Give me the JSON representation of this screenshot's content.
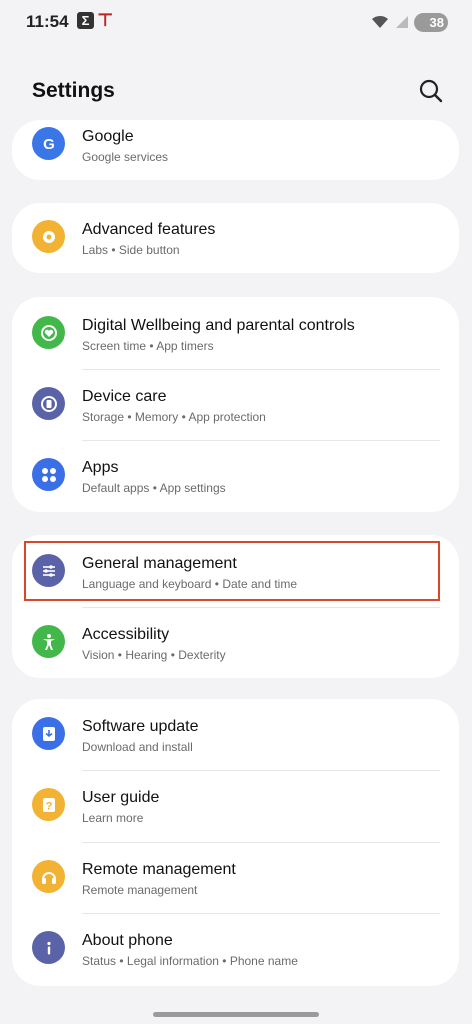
{
  "status": {
    "time": "11:54",
    "battery": "38"
  },
  "header": {
    "title": "Settings"
  },
  "colors": {
    "google": "#3a76e8",
    "advanced": "#f2b233",
    "wellbeing": "#42b74a",
    "device_care": "#5a63a8",
    "apps": "#3a6fe8",
    "general": "#5a63a8",
    "accessibility": "#42b74a",
    "software": "#3a6fe8",
    "user_guide": "#f2b233",
    "remote": "#f2b233",
    "about": "#5a63a8",
    "highlight": "#d9472a"
  },
  "items": {
    "google": {
      "title": "Google",
      "sub": "Google services"
    },
    "advanced": {
      "title": "Advanced features",
      "sub": "Labs  •  Side button"
    },
    "wellbeing": {
      "title": "Digital Wellbeing and parental controls",
      "sub": "Screen time  •  App timers"
    },
    "device_care": {
      "title": "Device care",
      "sub": "Storage  •  Memory  •  App protection"
    },
    "apps": {
      "title": "Apps",
      "sub": "Default apps  •  App settings"
    },
    "general": {
      "title": "General management",
      "sub": "Language and keyboard  •  Date and time"
    },
    "accessibility": {
      "title": "Accessibility",
      "sub": "Vision  •  Hearing  •  Dexterity"
    },
    "software": {
      "title": "Software update",
      "sub": "Download and install"
    },
    "user_guide": {
      "title": "User guide",
      "sub": "Learn more"
    },
    "remote": {
      "title": "Remote management",
      "sub": "Remote management"
    },
    "about": {
      "title": "About phone",
      "sub": "Status  •  Legal information  •  Phone name"
    }
  }
}
